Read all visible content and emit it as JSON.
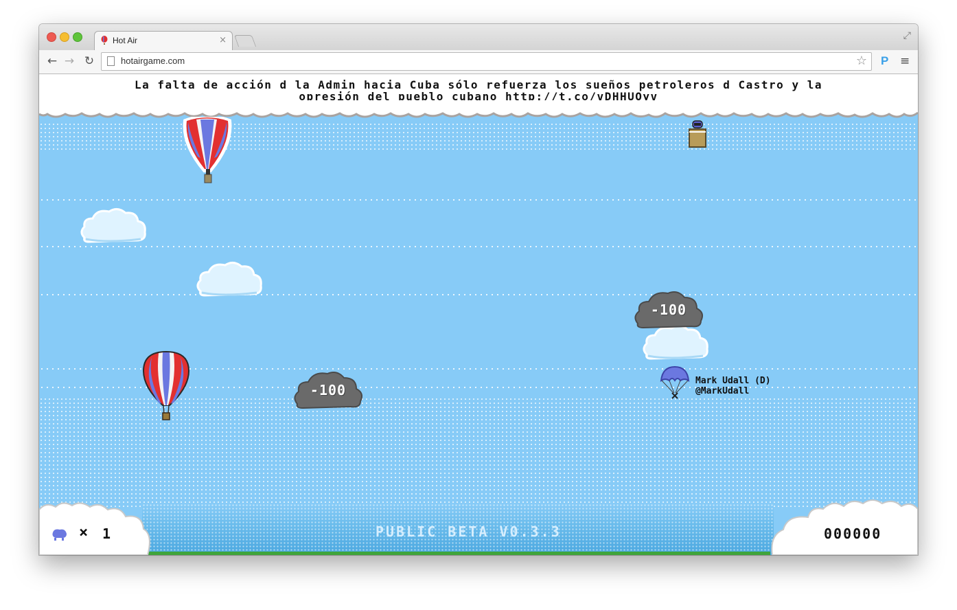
{
  "browser": {
    "tab_title": "Hot Air",
    "tab_close": "×",
    "url": "hotairgame.com",
    "extension_label": "P",
    "icons": [
      "back-arrow-icon",
      "forward-arrow-icon",
      "reload-icon",
      "page-icon",
      "bookmark-star-icon",
      "menu-icon",
      "fullscreen-icon",
      "tab-close-icon"
    ]
  },
  "game": {
    "tweet_line1": "La falta de acción d la Admin hacia Cuba sólo refuerza los sueños petroleros d Castro y la",
    "tweet_line2": "opresión del pueblo cubano http://t.co/vDHHUOyv",
    "storm_cloud_1": "-100",
    "storm_cloud_2": "-100",
    "parachuter_name": "Mark Udall (D)",
    "parachuter_handle": "@MarkUdall",
    "lives_symbol": "×",
    "lives_count": "1",
    "version": "PUBLIC BETA V0.3.3",
    "score": "000000",
    "colors": {
      "sky": "#87cbf7",
      "balloon_red": "#e23030",
      "balloon_blue": "#6b78e0",
      "storm": "#666666",
      "grass": "#3fa43b"
    }
  }
}
